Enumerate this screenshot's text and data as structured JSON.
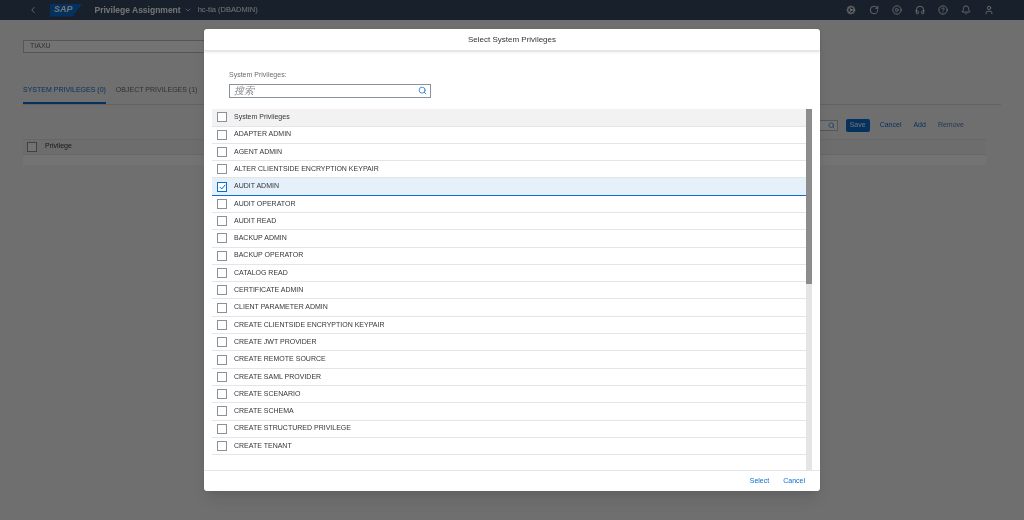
{
  "shell": {
    "logo": "SAP",
    "title": "Privilege Assignment",
    "system": "hc-tia (DBADMIN)"
  },
  "page": {
    "user_field": {
      "value": "TIAXU"
    },
    "tabs": [
      {
        "label": "SYSTEM PRIVILEGES (0)",
        "selected": true
      },
      {
        "label": "OBJECT PRIVILEGES (1)",
        "selected": false
      }
    ],
    "toolbar": [
      {
        "label": "Save",
        "kind": "primary",
        "disabled": false
      },
      {
        "label": "Cancel",
        "kind": "link",
        "disabled": false
      },
      {
        "label": "Add",
        "kind": "link",
        "disabled": false
      },
      {
        "label": "Remove",
        "kind": "link",
        "disabled": true
      }
    ],
    "table": {
      "columns": [
        "Privilege"
      ],
      "select_all_checked": false
    }
  },
  "dialog": {
    "title": "Select System Privileges",
    "search": {
      "label": "System Privileges:",
      "placeholder": "搜索"
    },
    "list": {
      "header": "System Privileges",
      "select_all_checked": false,
      "items": [
        {
          "label": "ADAPTER ADMIN",
          "checked": false
        },
        {
          "label": "AGENT ADMIN",
          "checked": false
        },
        {
          "label": "ALTER CLIENTSIDE ENCRYPTION KEYPAIR",
          "checked": false
        },
        {
          "label": "AUDIT ADMIN",
          "checked": true
        },
        {
          "label": "AUDIT OPERATOR",
          "checked": false
        },
        {
          "label": "AUDIT READ",
          "checked": false
        },
        {
          "label": "BACKUP ADMIN",
          "checked": false
        },
        {
          "label": "BACKUP OPERATOR",
          "checked": false
        },
        {
          "label": "CATALOG READ",
          "checked": false
        },
        {
          "label": "CERTIFICATE ADMIN",
          "checked": false
        },
        {
          "label": "CLIENT PARAMETER ADMIN",
          "checked": false
        },
        {
          "label": "CREATE CLIENTSIDE ENCRYPTION KEYPAIR",
          "checked": false
        },
        {
          "label": "CREATE JWT PROVIDER",
          "checked": false
        },
        {
          "label": "CREATE REMOTE SOURCE",
          "checked": false
        },
        {
          "label": "CREATE SAML PROVIDER",
          "checked": false
        },
        {
          "label": "CREATE SCENARIO",
          "checked": false
        },
        {
          "label": "CREATE SCHEMA",
          "checked": false
        },
        {
          "label": "CREATE STRUCTURED PRIVILEGE",
          "checked": false
        },
        {
          "label": "CREATE TENANT",
          "checked": false
        }
      ]
    },
    "buttons": [
      "Select",
      "Cancel"
    ]
  }
}
